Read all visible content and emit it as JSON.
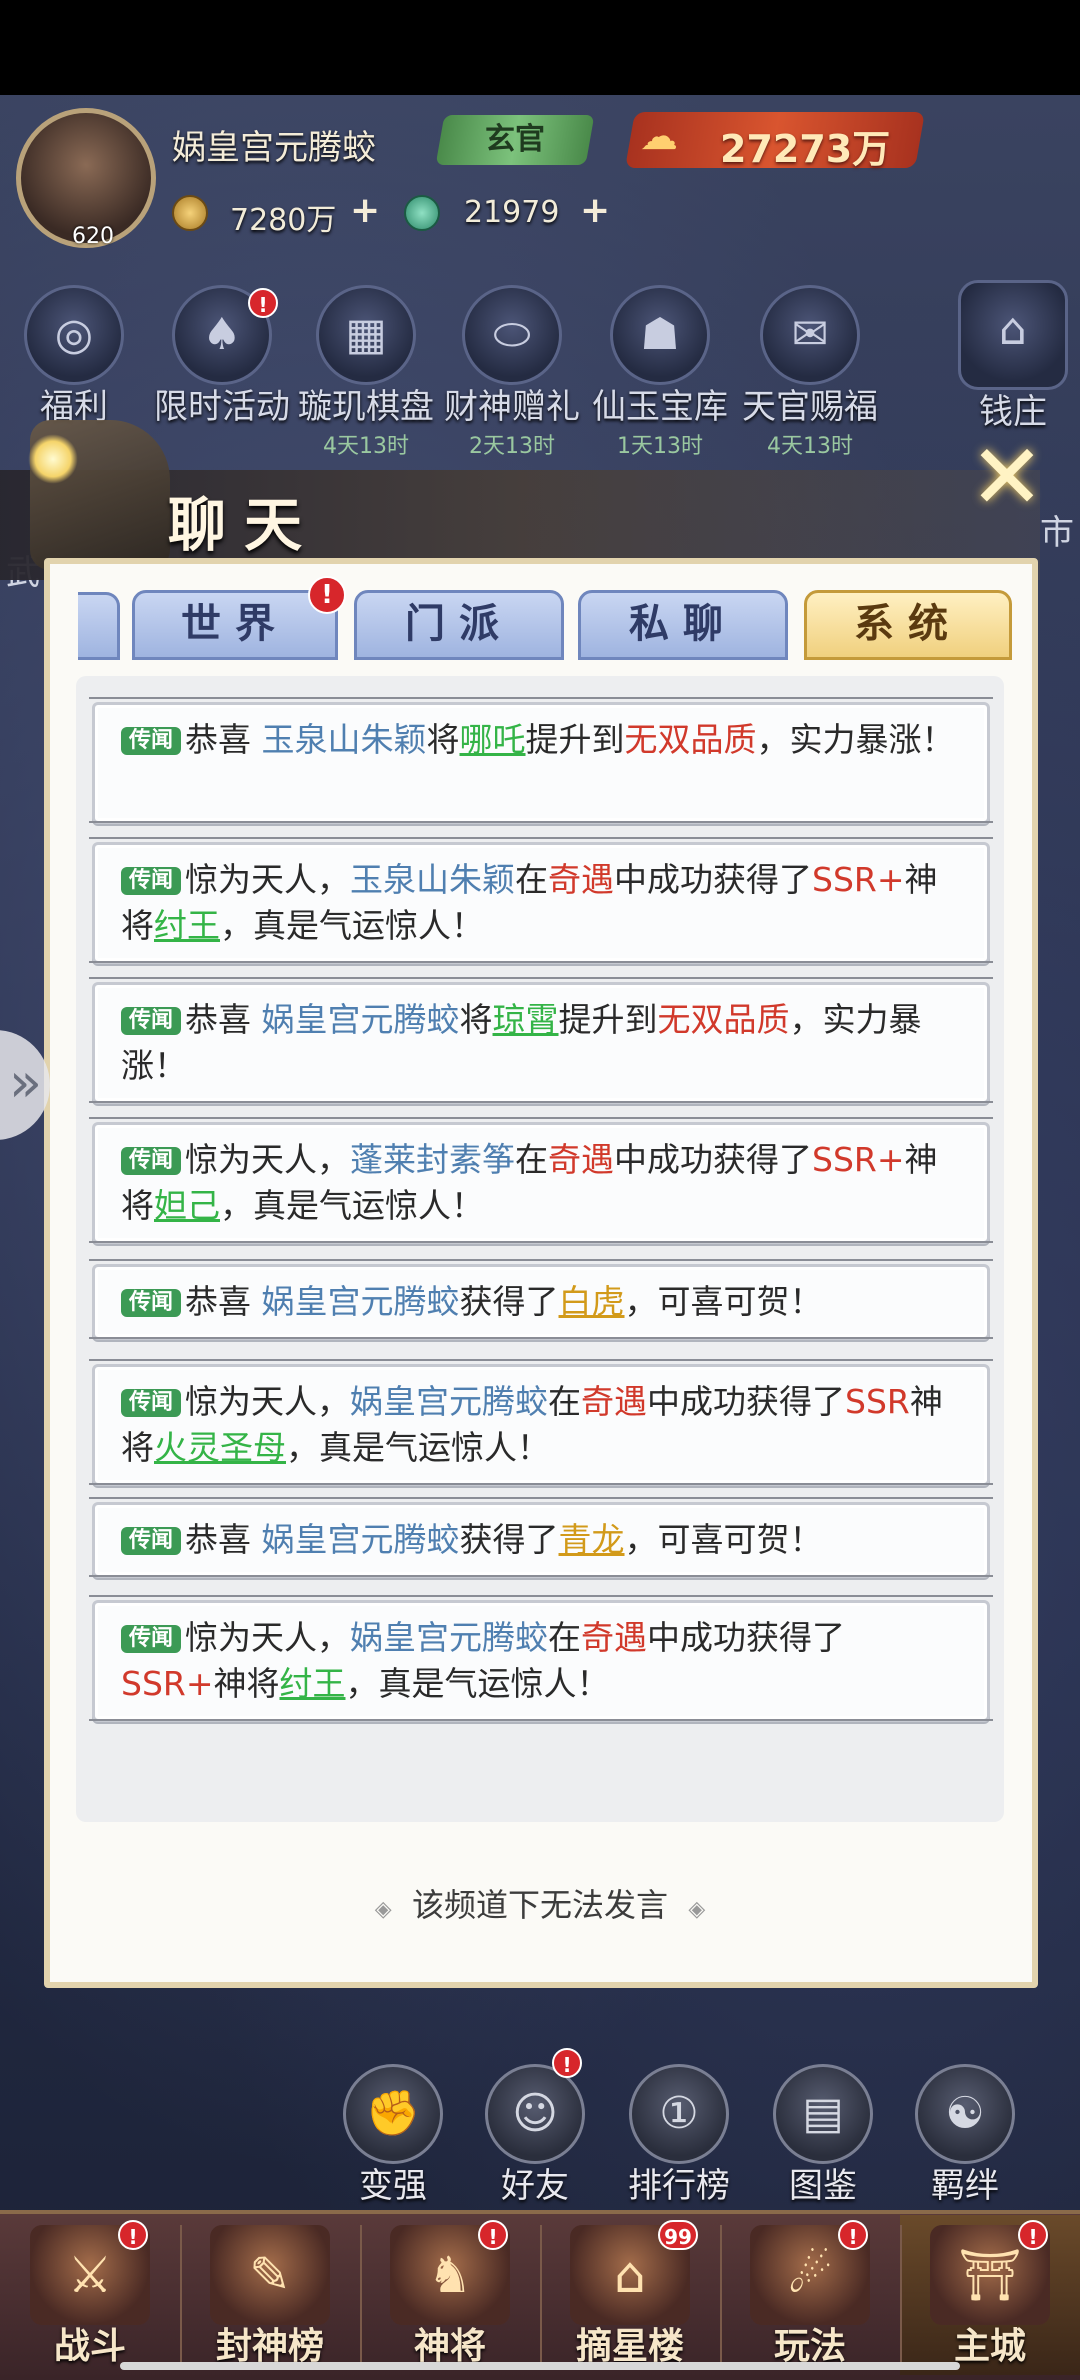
{
  "header": {
    "avatar_level": "620",
    "player_name": "娲皇宫元腾蛟",
    "rank": "玄官",
    "power": "27273万",
    "gold": "7280万",
    "jade": "21979",
    "plus": "+"
  },
  "activities": [
    {
      "label": "福利",
      "sub": "",
      "badge": false,
      "icon": "gift-icon",
      "glyph": "◎"
    },
    {
      "label": "限时活动",
      "sub": "",
      "badge": true,
      "icon": "cards-icon",
      "glyph": "♠"
    },
    {
      "label": "璇玑棋盘",
      "sub": "4天13时",
      "badge": false,
      "icon": "chessboard-icon",
      "glyph": "▦"
    },
    {
      "label": "财神赠礼",
      "sub": "2天13时",
      "badge": false,
      "icon": "ingot-icon",
      "glyph": "⬭"
    },
    {
      "label": "仙玉宝库",
      "sub": "1天13时",
      "badge": false,
      "icon": "treasure-icon",
      "glyph": "☗"
    },
    {
      "label": "天官赐福",
      "sub": "4天13时",
      "badge": false,
      "icon": "blessing-icon",
      "glyph": "✉"
    }
  ],
  "qianzhuang": {
    "label": "钱庄",
    "partial_label": "市",
    "left_partial": "武"
  },
  "chat": {
    "title": "聊天",
    "close": "✕",
    "tabs": [
      {
        "label": "世界",
        "active": false,
        "badge": "!"
      },
      {
        "label": "门派",
        "active": false
      },
      {
        "label": "私聊",
        "active": false
      },
      {
        "label": "系统",
        "active": true
      }
    ],
    "tag": "传闻",
    "messages": [
      {
        "p1": "恭喜 ",
        "player": "玉泉山朱颖",
        "p2": "将",
        "item": "哪吒",
        "item_style": "green",
        "p3": "提升到",
        "hl": "无双品质",
        "p4": "，实力暴涨！",
        "p5": ""
      },
      {
        "p1": "惊为天人，",
        "player": "玉泉山朱颖",
        "p2": "在",
        "item": "",
        "item_style": "",
        "p3": "",
        "hl": "奇遇",
        "p4": "中成功获得了",
        "hl2": "SSR+",
        "p5": "神将",
        "item2": "纣王",
        "p6": "，真是气运惊人！"
      },
      {
        "p1": "恭喜 ",
        "player": "娲皇宫元腾蛟",
        "p2": "将",
        "item": "琼霄",
        "item_style": "green",
        "p3": "提升到",
        "hl": "无双品质",
        "p4": "，实力暴涨！",
        "p5": ""
      },
      {
        "p1": "惊为天人，",
        "player": "蓬莱封素筝",
        "p2": "在",
        "item": "",
        "item_style": "",
        "p3": "",
        "hl": "奇遇",
        "p4": "中成功获得了",
        "hl2": "SSR+",
        "p5": "神将",
        "item2": "妲己",
        "p6": "，真是气运惊人！"
      },
      {
        "p1": "恭喜 ",
        "player": "娲皇宫元腾蛟",
        "p2": "获得了",
        "item": "白虎",
        "item_style": "gold",
        "p3": "，可喜可贺！"
      },
      {
        "p1": "惊为天人，",
        "player": "娲皇宫元腾蛟",
        "p2": "在",
        "hl": "奇遇",
        "p4": "中成功获得了",
        "hl2": "SSR",
        "p5": "神将",
        "item2": "火灵圣母",
        "p6": "，真是气运惊人！"
      },
      {
        "p1": "恭喜 ",
        "player": "娲皇宫元腾蛟",
        "p2": "获得了",
        "item": "青龙",
        "item_style": "gold",
        "p3": "，可喜可贺！"
      },
      {
        "p1": "惊为天人，",
        "player": "娲皇宫元腾蛟",
        "p2": "在",
        "hl": "奇遇",
        "p4": "中成功获得了",
        "hl2": "SSR+",
        "p5": "神将",
        "item2": "纣王",
        "p6": "，真是气运惊人！"
      }
    ],
    "footer_note": "该频道下无法发言"
  },
  "mid_nav": [
    {
      "label": "变强",
      "icon": "fist-icon",
      "glyph": "✊",
      "badge": false
    },
    {
      "label": "好友",
      "icon": "friends-icon",
      "glyph": "☺",
      "badge": true
    },
    {
      "label": "排行榜",
      "icon": "ranking-icon",
      "glyph": "①",
      "badge": false
    },
    {
      "label": "图鉴",
      "icon": "book-icon",
      "glyph": "▤",
      "badge": false
    },
    {
      "label": "羁绊",
      "icon": "bond-icon",
      "glyph": "☯",
      "badge": false
    }
  ],
  "bottom_nav": [
    {
      "label": "战斗",
      "icon": "sword-icon",
      "glyph": "⚔",
      "badge": "!"
    },
    {
      "label": "封神榜",
      "icon": "scroll-icon",
      "glyph": "✎",
      "badge": ""
    },
    {
      "label": "神将",
      "icon": "helmet-icon",
      "glyph": "♞",
      "badge": "!"
    },
    {
      "label": "摘星楼",
      "icon": "tower-icon",
      "glyph": "⌂",
      "badge": "99"
    },
    {
      "label": "玩法",
      "icon": "play-icon",
      "glyph": "☄",
      "badge": "!"
    },
    {
      "label": "主城",
      "icon": "palace-icon",
      "glyph": "⛩",
      "badge": "!",
      "active": true
    }
  ]
}
